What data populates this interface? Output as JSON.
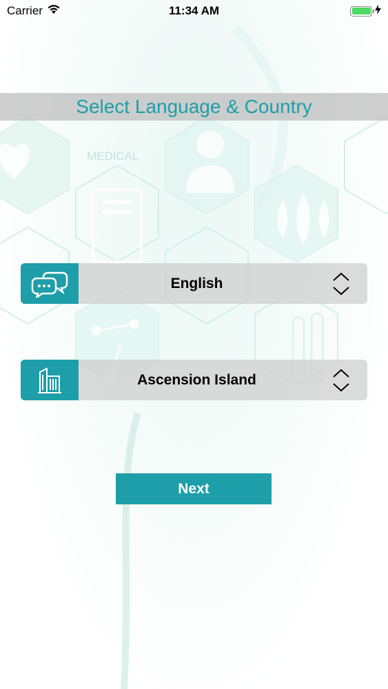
{
  "status_bar": {
    "carrier": "Carrier",
    "time": "11:34 AM",
    "battery_level": 1.0,
    "battery_color": "#4cd964"
  },
  "background": {
    "watermark_text": "MEDICAL"
  },
  "header": {
    "title": "Select Language & Country"
  },
  "language_picker": {
    "icon": "chat-bubbles-icon",
    "selected": "English"
  },
  "country_picker": {
    "icon": "building-icon",
    "selected": "Ascension Island"
  },
  "next_button": {
    "label": "Next"
  },
  "colors": {
    "accent": "#1e9ea9",
    "picker_bg": "#cdcdcd"
  }
}
